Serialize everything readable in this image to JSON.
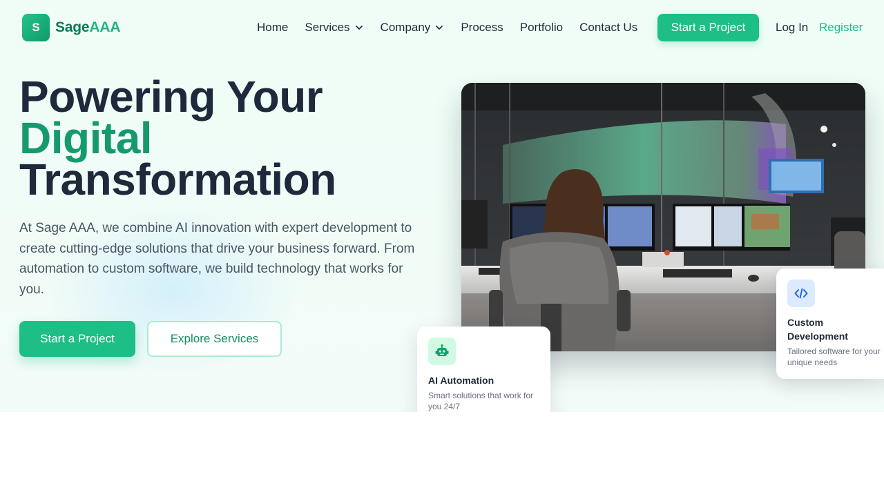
{
  "brand": {
    "mark": "S",
    "name_part1": "Sage",
    "name_part2": "AAA"
  },
  "nav": {
    "links": [
      "Home",
      "Services",
      "Company",
      "Process",
      "Portfolio",
      "Contact Us"
    ],
    "cta": "Start a Project",
    "login": "Log In",
    "register": "Register"
  },
  "hero": {
    "headline_line1": "Powering Your",
    "headline_line2": "Digital",
    "headline_line3": "Transformation",
    "description": "At Sage AAA, we combine AI innovation with expert development to create cutting-edge solutions that drive your business forward. From automation to custom software, we build technology that works for you.",
    "primary_button": "Start a Project",
    "secondary_button": "Explore Services"
  },
  "cards": {
    "ai": {
      "icon": "robot-icon",
      "title": "AI Automation",
      "subtitle": "Smart solutions that work for you 24/7"
    },
    "dev": {
      "icon": "code-icon",
      "title": "Custom Development",
      "subtitle": "Tailored software for your unique needs"
    }
  },
  "colors": {
    "accent": "#1ebf86",
    "accent_dark": "#159a6e",
    "heading": "#1e293b",
    "body_text": "#4b5563"
  }
}
